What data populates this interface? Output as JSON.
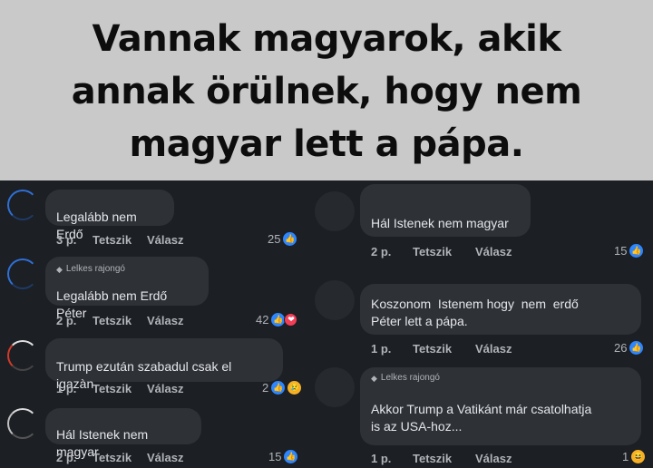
{
  "headline": {
    "lines": [
      "Vannak magyarok, akik",
      "annak örülnek, hogy nem",
      "magyar lett a pápa."
    ]
  },
  "actions": {
    "like": "Tetszik",
    "reply": "Válasz"
  },
  "left_comments": [
    {
      "badge": "",
      "text_lines": [
        "Legalább nem Erdő"
      ],
      "time": "3 p.",
      "reaction_count": "25",
      "reactions": [
        "like"
      ]
    },
    {
      "badge": "Lelkes rajongó",
      "text_lines": [
        "Legalább nem Erdő Péter"
      ],
      "time": "2 p.",
      "reaction_count": "42",
      "reactions": [
        "like",
        "love"
      ]
    },
    {
      "badge": "",
      "text_lines": [
        "Trump ezután szabadul csak el igazàn"
      ],
      "time": "1 p.",
      "reaction_count": "2",
      "reactions": [
        "like",
        "sad"
      ]
    },
    {
      "badge": "",
      "text_lines": [
        "Hál Istenek nem magyar"
      ],
      "time": "2 p.",
      "reaction_count": "15",
      "reactions": [
        "like"
      ]
    }
  ],
  "right_comments": [
    {
      "badge": "",
      "text_lines": [
        "Hál Istenek nem magyar"
      ],
      "time": "2 p.",
      "reaction_count": "15",
      "reactions": [
        "like"
      ]
    },
    {
      "badge": "",
      "text_lines": [
        "Koszonom  Istenem hogy  nem  erdő",
        "Péter lett a pápa."
      ],
      "time": "1 p.",
      "reaction_count": "26",
      "reactions": [
        "like"
      ]
    },
    {
      "badge": "Lelkes rajongó",
      "text_lines": [
        "Akkor Trump a Vatikánt már csatolhatja",
        "is az USA-hoz..."
      ],
      "time": "1 p.",
      "reaction_count": "1",
      "reactions": [
        "haha"
      ]
    }
  ],
  "icons": {
    "like": "👍",
    "love": "❤",
    "sad": "😢",
    "haha": "😆",
    "badge": "💎"
  },
  "colors": {
    "headline_bg": "#c9c9c9",
    "thread_bg": "#1c1f23",
    "bubble_bg": "#2e3135",
    "like_blue": "#2d86ff"
  }
}
